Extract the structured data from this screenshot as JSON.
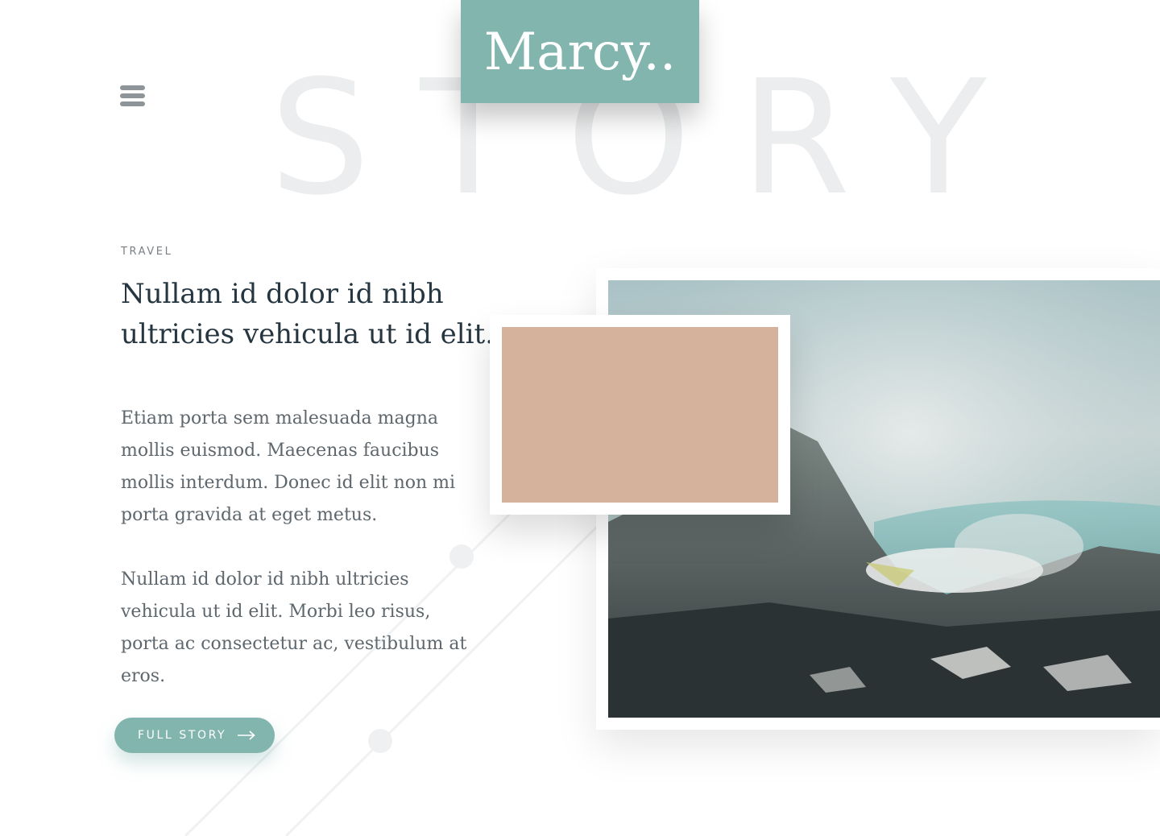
{
  "brand": {
    "logo": "Marcy.."
  },
  "background_word": "STORY",
  "menu": {
    "icon": "hamburger-menu-icon"
  },
  "article": {
    "category": "TRAVEL",
    "headline": "Nullam id dolor id nibh ultricies vehicula ut id elit.",
    "paragraphs": [
      "Etiam porta sem malesuada magna mollis euismod. Maecenas faucibus mollis interdum. Donec id elit non mi porta gravida at eget metus.",
      "Nullam id dolor id nibh ultricies vehicula ut id elit. Morbi leo risus, porta ac consectetur ac, vestibulum at eros."
    ],
    "cta_label": "FULL STORY",
    "cta_icon": "arrow-right-icon"
  },
  "images": {
    "main_alt": "volcanic-crater-landscape",
    "thumbnail_color": "#d4b29b"
  },
  "colors": {
    "accent": "#81b5ae",
    "heading": "#263640",
    "body": "#5e676d",
    "background_word": "#ebedee"
  }
}
